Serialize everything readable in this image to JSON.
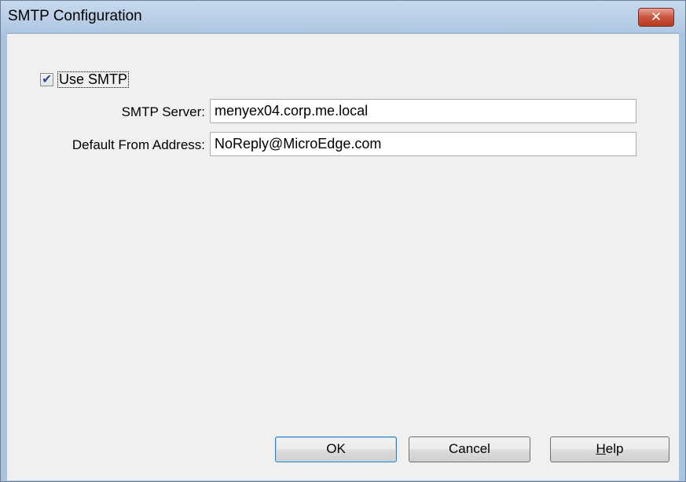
{
  "window": {
    "title": "SMTP Configuration",
    "close_label": "✕"
  },
  "form": {
    "use_smtp": {
      "label": "Use SMTP",
      "checked": true,
      "check_glyph": "✔"
    },
    "smtp_server": {
      "label": "SMTP Server:",
      "value": "menyex04.corp.me.local"
    },
    "default_from": {
      "label": "Default From Address:",
      "value": "NoReply@MicroEdge.com"
    }
  },
  "buttons": {
    "ok": "OK",
    "cancel": "Cancel",
    "help_mnemonic": "H",
    "help_rest": "elp"
  }
}
